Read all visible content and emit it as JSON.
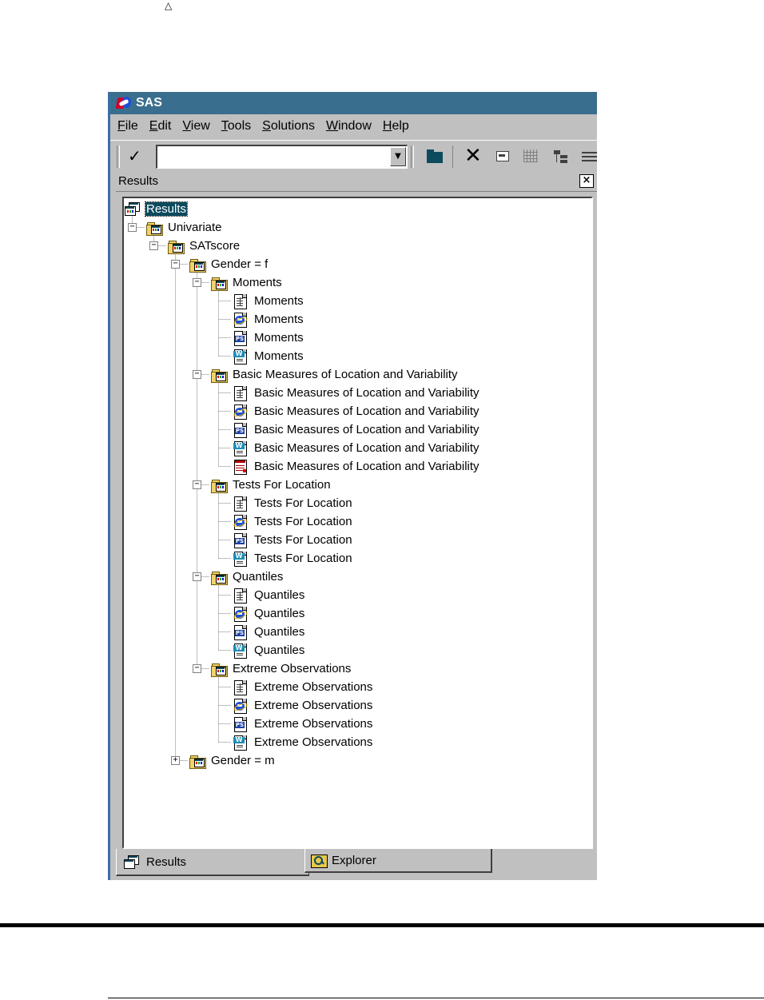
{
  "page": {
    "top_mark": "△"
  },
  "window": {
    "title": "SAS",
    "menu": [
      {
        "label": "File",
        "accel": "F",
        "rest": "ile"
      },
      {
        "label": "Edit",
        "accel": "E",
        "rest": "dit"
      },
      {
        "label": "View",
        "accel": "V",
        "rest": "iew"
      },
      {
        "label": "Tools",
        "accel": "T",
        "rest": "ools"
      },
      {
        "label": "Solutions",
        "accel": "S",
        "rest": "olutions"
      },
      {
        "label": "Window",
        "accel": "W",
        "rest": "indow"
      },
      {
        "label": "Help",
        "accel": "H",
        "rest": "elp"
      }
    ],
    "toolbar": {
      "check_glyph": "✓",
      "command_value": "",
      "dropdown_glyph": "▼",
      "close_glyph": "✕",
      "icons": [
        "checkmark-icon",
        "open-folder-icon",
        "delete-icon",
        "properties-icon",
        "details-grid-icon",
        "tree-view-icon",
        "list-view-icon"
      ]
    },
    "results_pane": {
      "title": "Results",
      "close_glyph": "×"
    },
    "tree": [
      {
        "label": "Results",
        "icon": "results",
        "depth": 0,
        "selected": true
      },
      {
        "label": "Univariate",
        "icon": "folder",
        "depth": 1,
        "expander": "−"
      },
      {
        "label": "SATscore",
        "icon": "folder",
        "depth": 2,
        "expander": "−"
      },
      {
        "label": "Gender = f",
        "icon": "folder",
        "depth": 3,
        "expander": "−"
      },
      {
        "label": "Moments",
        "icon": "folder",
        "depth": 4,
        "expander": "−"
      },
      {
        "label": "Moments",
        "icon": "listing",
        "depth": 5
      },
      {
        "label": "Moments",
        "icon": "html",
        "depth": 5
      },
      {
        "label": "Moments",
        "icon": "ps",
        "depth": 5
      },
      {
        "label": "Moments",
        "icon": "rtf",
        "depth": 5
      },
      {
        "label": "Basic Measures of Location and Variability",
        "icon": "folder",
        "depth": 4,
        "expander": "−"
      },
      {
        "label": "Basic Measures of Location and Variability",
        "icon": "listing",
        "depth": 5
      },
      {
        "label": "Basic Measures of Location and Variability",
        "icon": "html",
        "depth": 5
      },
      {
        "label": "Basic Measures of Location and Variability",
        "icon": "ps",
        "depth": 5
      },
      {
        "label": "Basic Measures of Location and Variability",
        "icon": "rtf",
        "depth": 5
      },
      {
        "label": "Basic Measures of Location and Variability",
        "icon": "data",
        "depth": 5
      },
      {
        "label": "Tests For Location",
        "icon": "folder",
        "depth": 4,
        "expander": "−"
      },
      {
        "label": "Tests For Location",
        "icon": "listing",
        "depth": 5
      },
      {
        "label": "Tests For Location",
        "icon": "html",
        "depth": 5
      },
      {
        "label": "Tests For Location",
        "icon": "ps",
        "depth": 5
      },
      {
        "label": "Tests For Location",
        "icon": "rtf",
        "depth": 5
      },
      {
        "label": "Quantiles",
        "icon": "folder",
        "depth": 4,
        "expander": "−"
      },
      {
        "label": "Quantiles",
        "icon": "listing",
        "depth": 5
      },
      {
        "label": "Quantiles",
        "icon": "html",
        "depth": 5
      },
      {
        "label": "Quantiles",
        "icon": "ps",
        "depth": 5
      },
      {
        "label": "Quantiles",
        "icon": "rtf",
        "depth": 5
      },
      {
        "label": "Extreme Observations",
        "icon": "folder",
        "depth": 4,
        "expander": "−"
      },
      {
        "label": "Extreme Observations",
        "icon": "listing",
        "depth": 5
      },
      {
        "label": "Extreme Observations",
        "icon": "html",
        "depth": 5
      },
      {
        "label": "Extreme Observations",
        "icon": "ps",
        "depth": 5
      },
      {
        "label": "Extreme Observations",
        "icon": "rtf",
        "depth": 5
      },
      {
        "label": "Gender = m",
        "icon": "folder",
        "depth": 3,
        "expander": "+"
      }
    ],
    "tabs": [
      {
        "label": "Results",
        "icon": "results-tab-icon",
        "active": true
      },
      {
        "label": "Explorer",
        "icon": "explorer-tab-icon",
        "active": false
      }
    ]
  }
}
